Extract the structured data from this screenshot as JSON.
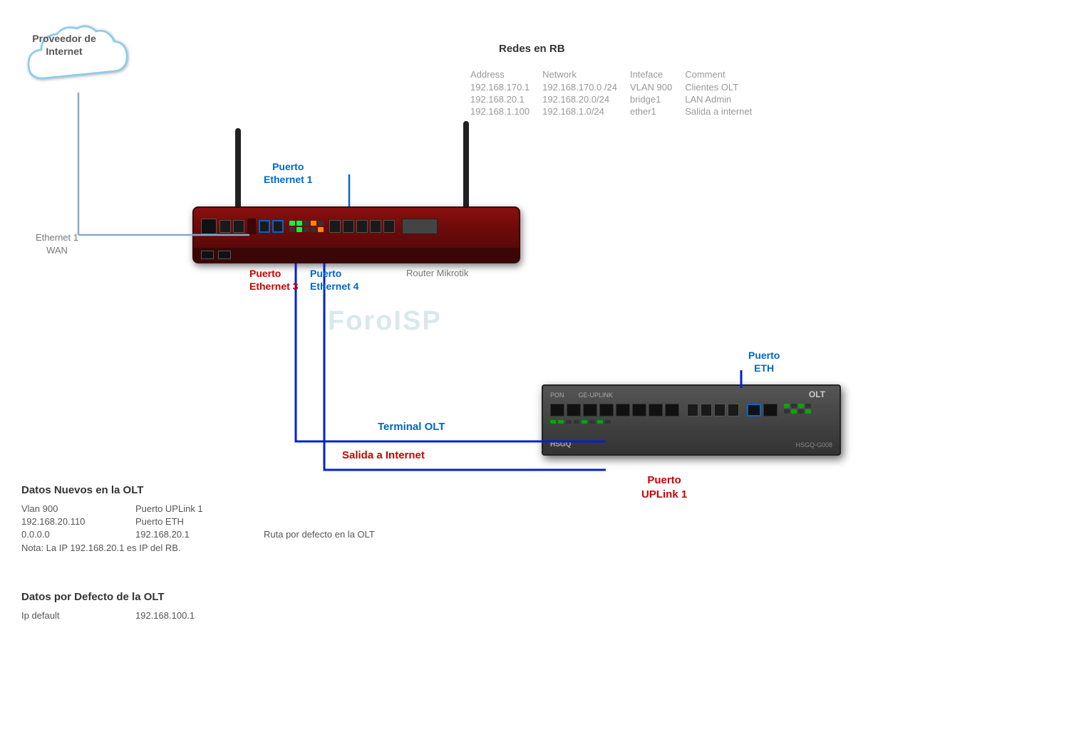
{
  "cloud": {
    "label_line1": "Proveedor de",
    "label_line2": "Internet"
  },
  "redes": {
    "title": "Redes en RB",
    "headers": [
      "Address",
      "Network",
      "Inteface",
      "Comment"
    ],
    "rows": [
      [
        "192.168.170.1",
        "192.168.170.0 /24",
        "VLAN 900",
        "Clientes OLT"
      ],
      [
        "192.168.20.1",
        "192.168.20.0/24",
        "bridge1",
        "LAN Admin"
      ],
      [
        "192.168.1.100",
        "192.168.1.0/24",
        "ether1",
        "Salida a internet"
      ]
    ]
  },
  "labels": {
    "ethernet1_wan": "Ethernet 1\nWAN",
    "puerto_eth1_line1": "Puerto",
    "puerto_eth1_line2": "Ethernet 1",
    "puerto_eth3_line1": "Puerto",
    "puerto_eth3_line2": "Ethernet 3",
    "puerto_eth4_line1": "Puerto",
    "puerto_eth4_line2": "Ethernet 4",
    "router_mikrotik": "Router Mikrotik",
    "terminal_olt": "Terminal OLT",
    "salida_internet": "Salida a Internet",
    "puerto_eth": "Puerto\nETH",
    "puerto_uplink1_line1": "Puerto",
    "puerto_uplink1_line2": "UPLink 1",
    "watermark": "ForoISP"
  },
  "datos_nuevos": {
    "title": "Datos Nuevos en  la OLT",
    "rows": [
      [
        "Vlan 900",
        "Puerto UPLink 1",
        ""
      ],
      [
        "192.168.20.110",
        "Puerto ETH",
        ""
      ],
      [
        "0.0.0.0",
        "192.168.20.1",
        "Ruta  por defecto en la OLT"
      ]
    ],
    "nota": "Nota: La IP 192.168.20.1 es IP del RB."
  },
  "datos_defecto": {
    "title": "Datos por Defecto de la OLT",
    "rows": [
      [
        "Ip default",
        "192.168.100.1",
        ""
      ]
    ]
  }
}
